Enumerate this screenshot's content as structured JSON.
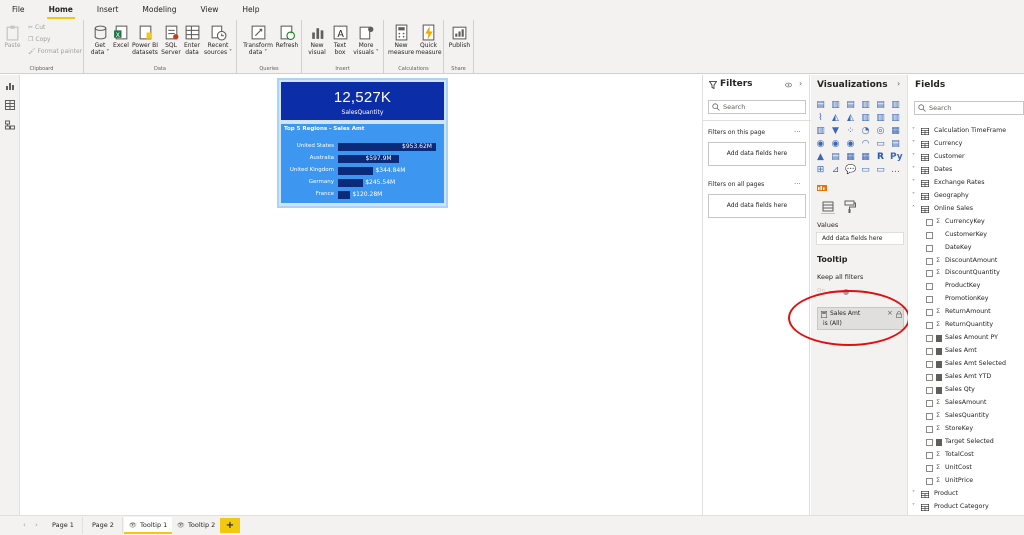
{
  "menu": {
    "items": [
      "File",
      "Home",
      "Insert",
      "Modeling",
      "View",
      "Help"
    ],
    "active": "Home"
  },
  "ribbon": {
    "clipboard": {
      "paste": "Paste",
      "cut": "Cut",
      "copy": "Copy",
      "format_painter": "Format painter",
      "label": "Clipboard"
    },
    "data": {
      "get_data": "Get data ˅",
      "excel": "Excel",
      "powerbi_datasets": "Power BI datasets",
      "sql_server": "SQL Server",
      "enter_data": "Enter data",
      "recent_sources": "Recent sources ˅",
      "label": "Data"
    },
    "queries": {
      "transform": "Transform data ˅",
      "refresh": "Refresh",
      "label": "Queries"
    },
    "insert": {
      "new_visual": "New visual",
      "text_box": "Text box",
      "more_visuals": "More visuals ˅",
      "label": "Insert"
    },
    "calculations": {
      "new_measure": "New measure",
      "quick_measure": "Quick measure",
      "label": "Calculations"
    },
    "share": {
      "publish": "Publish",
      "label": "Share"
    }
  },
  "kpi": {
    "value": "12,527K",
    "label": "SalesQuantity"
  },
  "chart_data": {
    "type": "bar",
    "title": "Top 5 Regions - Sales Amt",
    "categories": [
      "United States",
      "Australia",
      "United Kingdom",
      "Germany",
      "France"
    ],
    "values": [
      953.62,
      597.9,
      344.84,
      245.54,
      120.28
    ],
    "value_labels": [
      "$953.62M",
      "$597.9M",
      "$344.84M",
      "$245.54M",
      "$120.28M"
    ],
    "xlim": [
      0,
      953.62
    ],
    "bar_color": "#0b2a7a",
    "background_color": "#3d96ef"
  },
  "pages": {
    "tabs": [
      "Page 1",
      "Page 2",
      "Tooltip 1",
      "Tooltip 2"
    ],
    "active": "Tooltip 1",
    "add": "+"
  },
  "filters": {
    "title": "Filters",
    "search_placeholder": "Search",
    "on_this_page": "Filters on this page",
    "on_all_pages": "Filters on all pages",
    "add_fields": "Add data fields here",
    "more": "..."
  },
  "visualizations": {
    "title": "Visualizations",
    "values_label": "Values",
    "add_fields": "Add data fields here",
    "tooltip_title": "Tooltip",
    "keep_all_filters": "Keep all filters",
    "toggle_state": "On",
    "filter_card": {
      "field": "Sales Amt",
      "state": "is (All)"
    }
  },
  "fields": {
    "title": "Fields",
    "search_placeholder": "Search",
    "tables_top": [
      "Calculation TimeFrame",
      "Currency",
      "Customer",
      "Dates",
      "Exchange Rates",
      "Geography"
    ],
    "expanded_table": "Online Sales",
    "columns": [
      {
        "name": "CurrencyKey",
        "kind": "sigma"
      },
      {
        "name": "CustomerKey",
        "kind": "plain"
      },
      {
        "name": "DateKey",
        "kind": "plain"
      },
      {
        "name": "DiscountAmount",
        "kind": "sigma"
      },
      {
        "name": "DiscountQuantity",
        "kind": "sigma"
      },
      {
        "name": "ProductKey",
        "kind": "plain"
      },
      {
        "name": "PromotionKey",
        "kind": "plain"
      },
      {
        "name": "ReturnAmount",
        "kind": "sigma"
      },
      {
        "name": "ReturnQuantity",
        "kind": "sigma"
      },
      {
        "name": "Sales Amount PY",
        "kind": "calc"
      },
      {
        "name": "Sales Amt",
        "kind": "calc"
      },
      {
        "name": "Sales Amt Selected",
        "kind": "calc"
      },
      {
        "name": "Sales Amt YTD",
        "kind": "calc"
      },
      {
        "name": "Sales Qty",
        "kind": "calc"
      },
      {
        "name": "SalesAmount",
        "kind": "sigma"
      },
      {
        "name": "SalesQuantity",
        "kind": "sigma"
      },
      {
        "name": "StoreKey",
        "kind": "sigma"
      },
      {
        "name": "Target Selected",
        "kind": "calc"
      },
      {
        "name": "TotalCost",
        "kind": "sigma"
      },
      {
        "name": "UnitCost",
        "kind": "sigma"
      },
      {
        "name": "UnitPrice",
        "kind": "sigma"
      }
    ],
    "tables_bottom": [
      "Product",
      "Product Category"
    ]
  },
  "colors": {
    "accent": "#f2c811",
    "kpi_bg": "#0b2ea8",
    "highlight_ellipse": "#e01010"
  }
}
